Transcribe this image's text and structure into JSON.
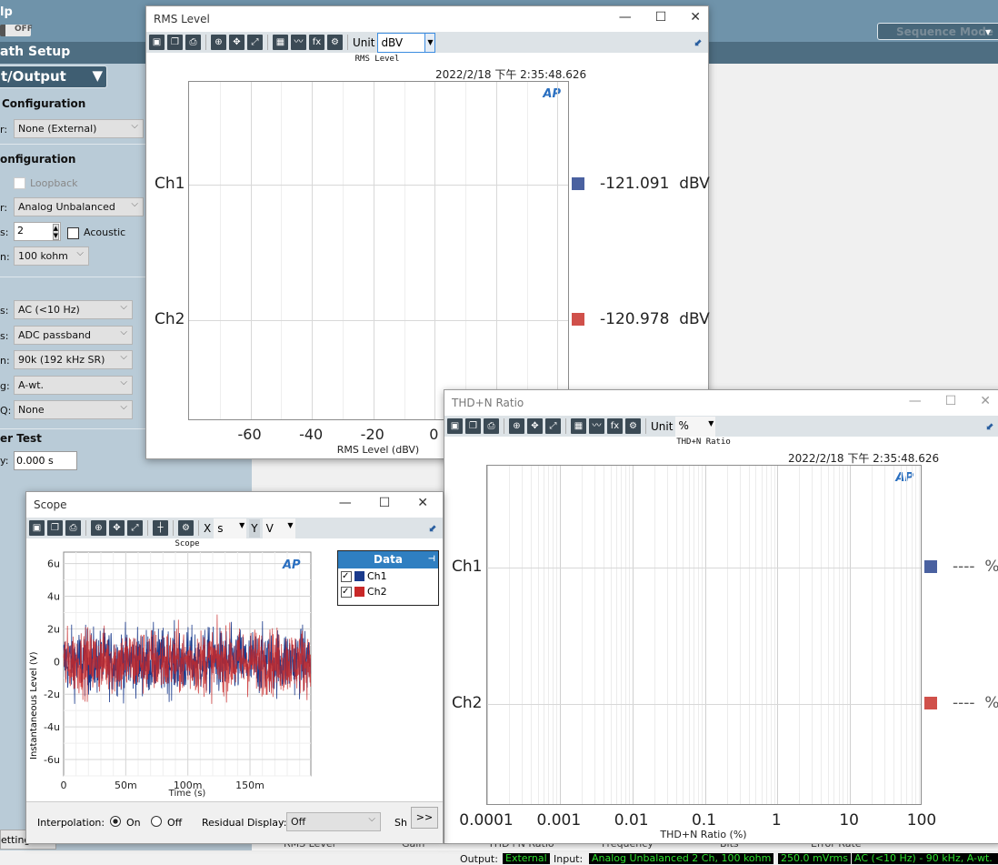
{
  "app": {
    "menu_fragment": "lp",
    "toggle": "OFF",
    "panel_title": "ath Setup",
    "section_select": "t/Output",
    "sequence_mode": "Sequence Mode"
  },
  "panel": {
    "gen_header": " Configuration",
    "gen_label": "r:",
    "gen_value": "None (External)",
    "in_header": "onfiguration",
    "loopback": "Loopback",
    "conn_label": "r:",
    "conn_value": "Analog Unbalanced",
    "ch_label": "s:",
    "ch_value": "2",
    "acoustic": "Acoustic",
    "imp_label": "n:",
    "imp_value": "100 kohm",
    "rows": [
      {
        "label": "s:",
        "value": "AC (<10 Hz)"
      },
      {
        "label": "s:",
        "value": "ADC passband"
      },
      {
        "label": "n:",
        "value": "90k (192 kHz SR)"
      },
      {
        "label": "g:",
        "value": "A-wt."
      },
      {
        "label": "Q:",
        "value": "None"
      }
    ],
    "test_header": "er Test",
    "delay_label": "y:",
    "delay_value": "0.000 s",
    "settings": "ettings"
  },
  "bottom_tabs": [
    "RMS Level",
    "Gain",
    "THD+N Ratio",
    "Frequency",
    "Bits",
    "Error Rate"
  ],
  "status": {
    "output_label": "Output:",
    "output": "External",
    "input_label": "Input:",
    "input": "Analog Unbalanced 2 Ch, 100 kohm",
    "level": "250.0 mVrms",
    "filter": "AC (<10 Hz) - 90 kHz, A-wt."
  },
  "rms": {
    "title": "RMS Level",
    "unit_label": "Unit",
    "unit": "dBV",
    "graph_title": "RMS Level",
    "timestamp": "2022/2/18 下午 2:35:48.626",
    "logo": "AP"
  },
  "thd": {
    "title": "THD+N Ratio",
    "unit_label": "Unit",
    "unit": "%",
    "graph_title": "THD+N Ratio",
    "timestamp": "2022/2/18 下午 2:35:48.626",
    "logo": "AP"
  },
  "scope": {
    "title": "Scope",
    "x_label": "X",
    "x_unit": "s",
    "y_label": "Y",
    "y_unit": "V",
    "graph_title": "Scope",
    "logo": "AP",
    "legend_title": "Data",
    "interp_label": "Interpolation:",
    "on": "On",
    "off": "Off",
    "residual_label": "Residual Display:",
    "residual_value": "Off",
    "sh": "Sh",
    "more": ">>"
  },
  "colors": {
    "ch1": "#4a61a0",
    "ch2": "#d0504a",
    "scope_ch1": "#1a3a8c",
    "scope_ch2": "#c82828",
    "panel": "#b9cbd7",
    "topbar": "#6f93aa"
  },
  "chart_data": [
    {
      "type": "bar",
      "title": "RMS Level",
      "xlabel": "RMS Level (dBV)",
      "categories": [
        "Ch1",
        "Ch2"
      ],
      "values": [
        -121.091,
        -120.978
      ],
      "value_labels": [
        "-121.091  dBV",
        "-120.978  dBV"
      ],
      "xticks": [
        "-60",
        "-40",
        "-20",
        "0"
      ],
      "xtick_values": [
        -60,
        -40,
        -20,
        0
      ],
      "xlim": [
        -80,
        44
      ],
      "grid": true
    },
    {
      "type": "bar",
      "title": "THD+N Ratio",
      "xlabel": "THD+N Ratio (%)",
      "categories": [
        "Ch1",
        "Ch2"
      ],
      "value_labels": [
        "----  %",
        "----  %"
      ],
      "xscale": "log",
      "xticks": [
        "0.0001",
        "0.001",
        "0.01",
        "0.1",
        "1",
        "10",
        "100"
      ],
      "xlim": [
        0.0001,
        100
      ],
      "grid": true
    },
    {
      "type": "line",
      "title": "Scope",
      "xlabel": "Time (s)",
      "ylabel": "Instantaneous Level (V)",
      "xticks": [
        "0",
        "50m",
        "100m",
        "150m"
      ],
      "xtick_values": [
        0,
        0.05,
        0.1,
        0.15
      ],
      "yticks": [
        "6u",
        "4u",
        "2u",
        "0",
        "-2u",
        "-4u",
        "-6u"
      ],
      "ytick_values": [
        6e-06,
        4e-06,
        2e-06,
        0,
        -2e-06,
        -4e-06,
        -6e-06
      ],
      "xlim": [
        0,
        0.199
      ],
      "ylim": [
        -7e-06,
        6.7e-06
      ],
      "series": [
        {
          "name": "Ch1"
        },
        {
          "name": "Ch2"
        }
      ],
      "grid": true,
      "legend": "right"
    }
  ]
}
